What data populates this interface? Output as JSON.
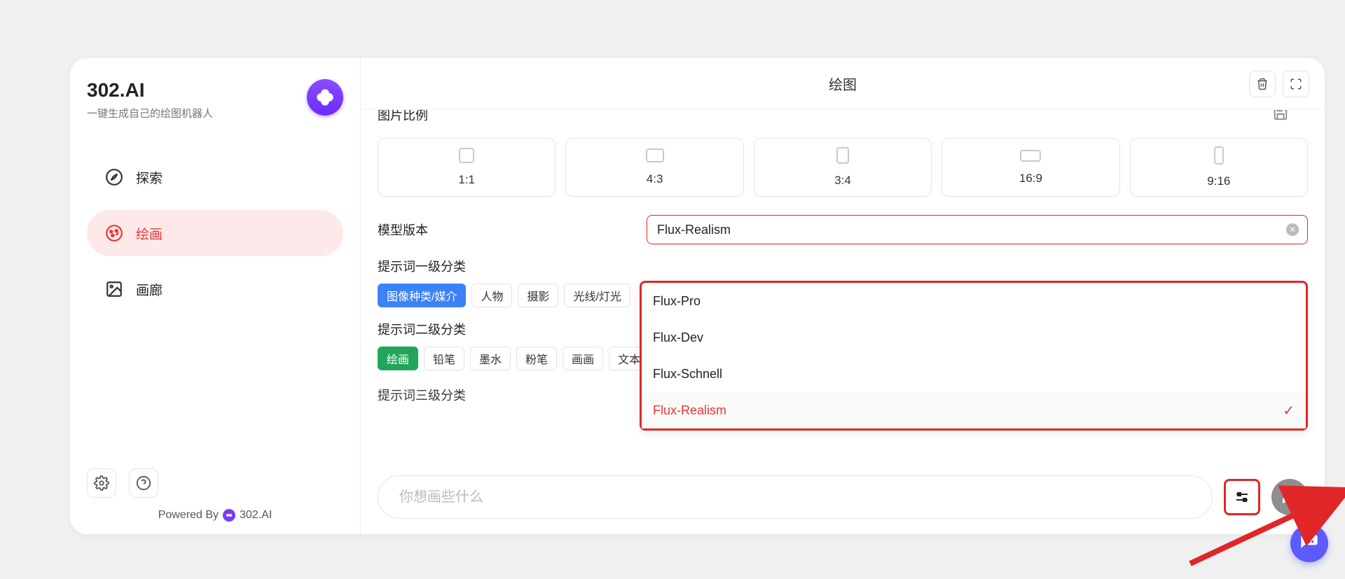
{
  "brand": {
    "title": "302.AI",
    "subtitle": "一键生成自己的绘图机器人"
  },
  "sidebar": {
    "items": [
      {
        "label": "探索"
      },
      {
        "label": "绘画"
      },
      {
        "label": "画廊"
      }
    ]
  },
  "footer": {
    "powered_prefix": "Powered By",
    "powered_name": "302.AI"
  },
  "main": {
    "title": "绘图",
    "aspect_label": "图片比例",
    "ratios": [
      "1:1",
      "4:3",
      "3:4",
      "16:9",
      "9:16"
    ],
    "model_label": "模型版本",
    "model_value": "Flux-Realism",
    "dropdown": [
      "Flux-Pro",
      "Flux-Dev",
      "Flux-Schnell",
      "Flux-Realism"
    ],
    "cat1_label": "提示词一级分类",
    "cat1_chips": [
      "图像种类/媒介",
      "人物",
      "摄影",
      "光线/灯光"
    ],
    "cat2_label": "提示词二级分类",
    "cat2_chips": [
      "绘画",
      "铅笔",
      "墨水",
      "粉笔",
      "画画",
      "文本"
    ],
    "cat3_label": "提示词三级分类",
    "composer_placeholder": "你想画些什么"
  }
}
